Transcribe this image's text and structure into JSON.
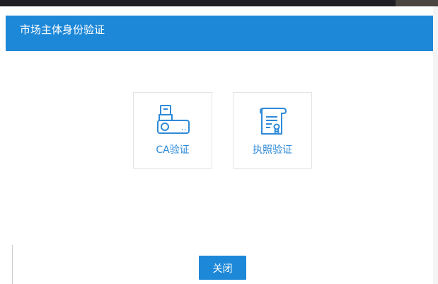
{
  "dialog": {
    "title": "市场主体身份验证",
    "options": [
      {
        "label": "CA验证",
        "icon": "usb-key-icon"
      },
      {
        "label": "执照验证",
        "icon": "license-certificate-icon"
      }
    ],
    "close_label": "关闭"
  },
  "colors": {
    "header": "#1e88d8",
    "accent_text": "#2f8ad8",
    "card_border": "#e3e3e3",
    "button": "#1e88d8"
  }
}
